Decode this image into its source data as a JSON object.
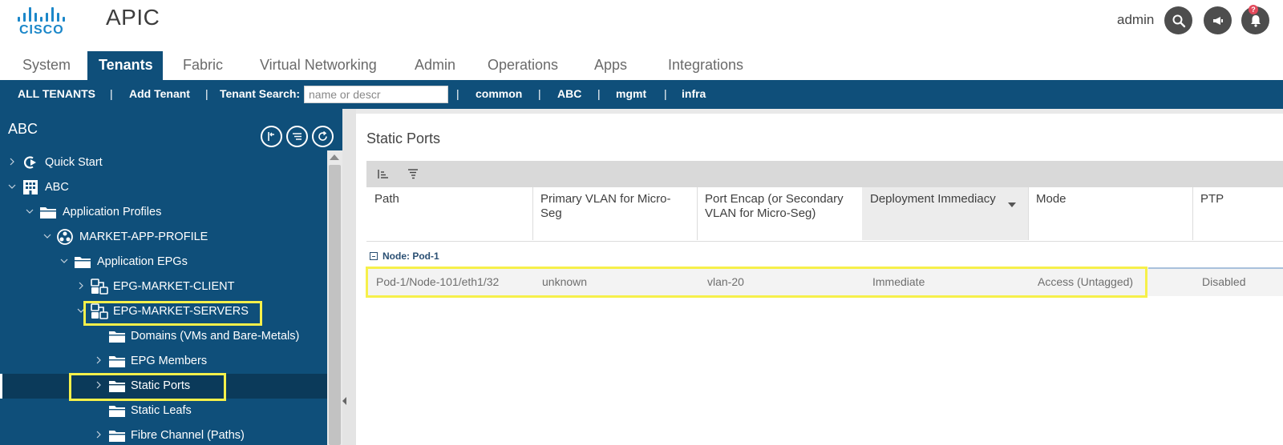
{
  "header": {
    "logo_text": "CISCO",
    "app_title": "APIC",
    "user": "admin",
    "notification_count": "?",
    "accent_color": "#0f4f7a",
    "logo_color": "#1b87c9"
  },
  "nav": {
    "tabs": [
      {
        "label": "System"
      },
      {
        "label": "Tenants",
        "active": true
      },
      {
        "label": "Fabric"
      },
      {
        "label": "Virtual Networking"
      },
      {
        "label": "Admin"
      },
      {
        "label": "Operations"
      },
      {
        "label": "Apps"
      },
      {
        "label": "Integrations"
      }
    ]
  },
  "subbar": {
    "all_tenants": "ALL TENANTS",
    "add_tenant": "Add Tenant",
    "tenant_search_label": "Tenant Search:",
    "search_placeholder": "name or descr",
    "separator": "|",
    "tenants": [
      "common",
      "ABC",
      "mgmt",
      "infra"
    ]
  },
  "sidebar": {
    "title": "ABC",
    "tools": [
      "collapse-icon",
      "filter-list-icon",
      "refresh-icon"
    ],
    "tree": [
      {
        "label": "Quick Start",
        "icon": "quick-start-icon",
        "expanded": false
      },
      {
        "label": "ABC",
        "icon": "tenant-building-icon",
        "expanded": true
      },
      {
        "label": "Application Profiles",
        "icon": "folder-icon",
        "expanded": true
      },
      {
        "label": "MARKET-APP-PROFILE",
        "icon": "app-profile-icon",
        "expanded": true
      },
      {
        "label": "Application EPGs",
        "icon": "folder-icon",
        "expanded": true
      },
      {
        "label": "EPG-MARKET-CLIENT",
        "icon": "epg-icon",
        "expanded": false
      },
      {
        "label": "EPG-MARKET-SERVERS",
        "icon": "epg-icon",
        "expanded": true,
        "highlighted": true
      },
      {
        "label": "Domains (VMs and Bare-Metals)",
        "icon": "folder-icon"
      },
      {
        "label": "EPG Members",
        "icon": "folder-icon",
        "expanded": false
      },
      {
        "label": "Static Ports",
        "icon": "folder-icon",
        "expanded": false,
        "selected": true,
        "highlighted": true
      },
      {
        "label": "Static Leafs",
        "icon": "folder-icon"
      },
      {
        "label": "Fibre Channel (Paths)",
        "icon": "folder-icon",
        "expanded": false
      }
    ]
  },
  "main": {
    "title": "Static Ports",
    "columns": [
      {
        "label": "Path"
      },
      {
        "label": "Primary VLAN for Micro-Seg"
      },
      {
        "label": "Port Encap (or Secondary VLAN for Micro-Seg)"
      },
      {
        "label": "Deployment Immediacy",
        "sorted": true
      },
      {
        "label": "Mode"
      },
      {
        "label": "PTP"
      }
    ],
    "group": {
      "label": "Node: Pod-1"
    },
    "rows": [
      {
        "cells": [
          "Pod-1/Node-101/eth1/32",
          "unknown",
          "vlan-20",
          "Immediate",
          "Access (Untagged)",
          "Disabled"
        ]
      }
    ]
  }
}
